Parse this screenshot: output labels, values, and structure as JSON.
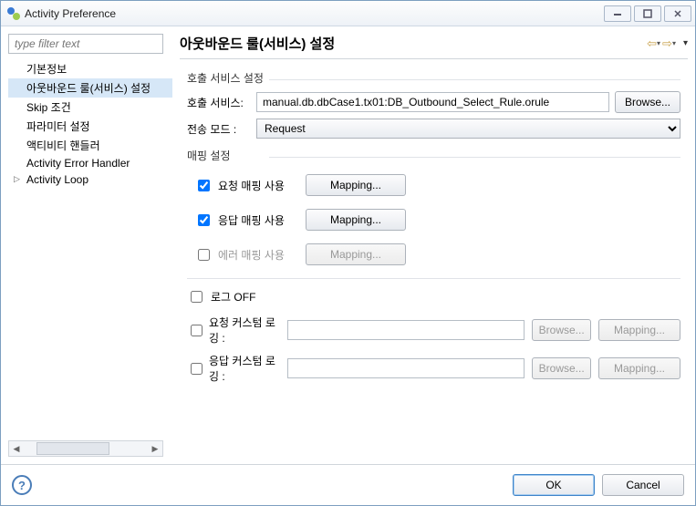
{
  "window": {
    "title": "Activity Preference"
  },
  "sidebar": {
    "filter_placeholder": "type filter text",
    "items": [
      {
        "label": "기본정보",
        "selected": false,
        "expandable": false
      },
      {
        "label": "아웃바운드 룰(서비스) 설정",
        "selected": true,
        "expandable": false
      },
      {
        "label": "Skip 조건",
        "selected": false,
        "expandable": false
      },
      {
        "label": "파라미터 설정",
        "selected": false,
        "expandable": false
      },
      {
        "label": "액티비티 핸들러",
        "selected": false,
        "expandable": false
      },
      {
        "label": "Activity Error Handler",
        "selected": false,
        "expandable": false
      },
      {
        "label": "Activity Loop",
        "selected": false,
        "expandable": true
      }
    ]
  },
  "page": {
    "title": "아웃바운드 룰(서비스) 설정"
  },
  "call_service": {
    "group_title": "호출 서비스 설정",
    "service_label": "호출 서비스:",
    "service_value": "manual.db.dbCase1.tx01:DB_Outbound_Select_Rule.orule",
    "browse_label": "Browse...",
    "mode_label": "전송 모드 :",
    "mode_value": "Request"
  },
  "mapping": {
    "group_title": "매핑 설정",
    "req_label": "요청 매핑 사용",
    "req_checked": true,
    "req_btn": "Mapping...",
    "resp_label": "응답 매핑 사용",
    "resp_checked": true,
    "resp_btn": "Mapping...",
    "err_label": "에러 매핑 사용",
    "err_checked": false,
    "err_btn": "Mapping..."
  },
  "log": {
    "off_label": "로그 OFF",
    "off_checked": false,
    "req_label": "요청 커스텀 로깅 :",
    "req_checked": false,
    "req_value": "",
    "resp_label": "응답 커스텀 로깅 :",
    "resp_checked": false,
    "resp_value": "",
    "browse_label": "Browse...",
    "mapping_label": "Mapping..."
  },
  "footer": {
    "ok": "OK",
    "cancel": "Cancel"
  }
}
